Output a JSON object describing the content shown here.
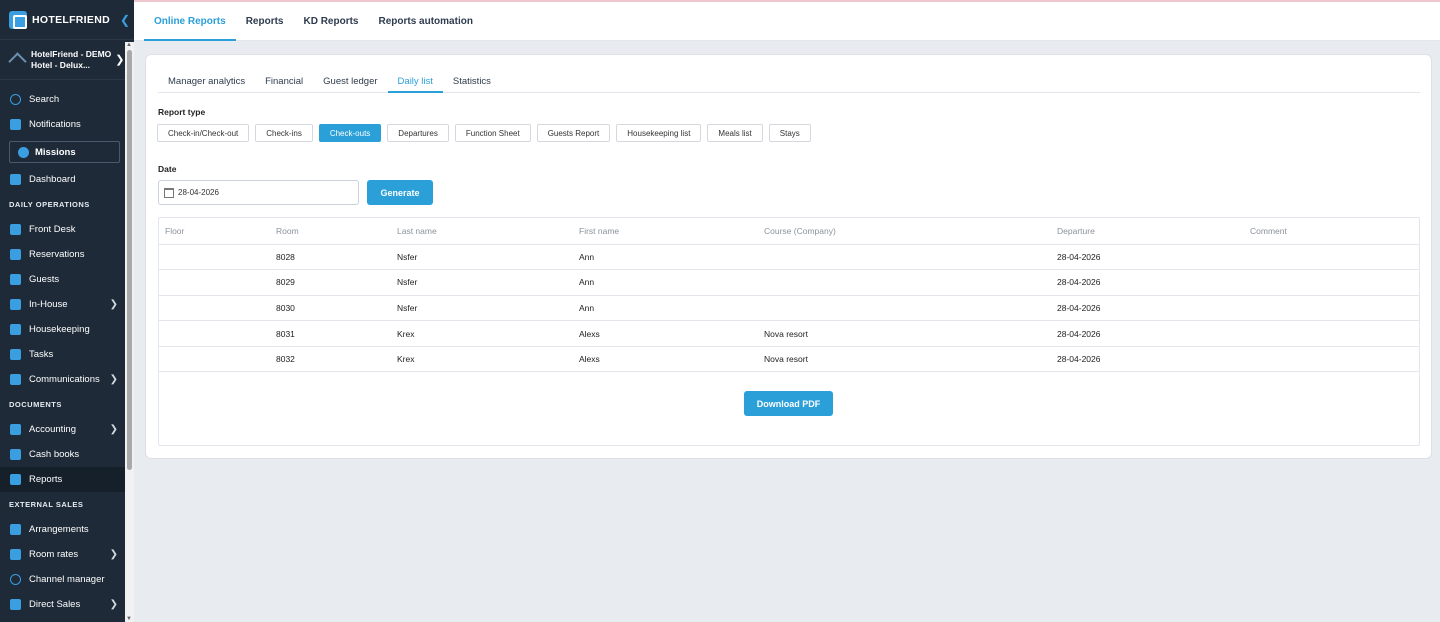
{
  "app": {
    "logo_text": "HOTELFRIEND",
    "hotel_name_line1": "HotelFriend - DEMO",
    "hotel_name_line2": "Hotel - Delux..."
  },
  "sidebar": {
    "search": "Search",
    "notifications": "Notifications",
    "missions": "Missions",
    "dashboard": "Dashboard",
    "section_daily": "DAILY OPERATIONS",
    "front_desk": "Front Desk",
    "reservations": "Reservations",
    "guests": "Guests",
    "in_house": "In-House",
    "housekeeping": "Housekeeping",
    "tasks": "Tasks",
    "communications": "Communications",
    "section_documents": "DOCUMENTS",
    "accounting": "Accounting",
    "cash_books": "Cash books",
    "reports": "Reports",
    "section_external": "EXTERNAL SALES",
    "arrangements": "Arrangements",
    "room_rates": "Room rates",
    "channel_manager": "Channel manager",
    "direct_sales": "Direct Sales"
  },
  "topnav": {
    "tabs": [
      "Online Reports",
      "Reports",
      "KD Reports",
      "Reports automation"
    ]
  },
  "subtabs": [
    "Manager analytics",
    "Financial",
    "Guest ledger",
    "Daily list",
    "Statistics"
  ],
  "form": {
    "report_type_label": "Report type",
    "report_types": [
      "Check-in/Check-out",
      "Check-ins",
      "Check-outs",
      "Departures",
      "Function Sheet",
      "Guests Report",
      "Housekeeping list",
      "Meals list",
      "Stays"
    ],
    "date_label": "Date",
    "date_value": "28-04-2026",
    "generate": "Generate"
  },
  "table": {
    "headers": [
      "Floor",
      "Room",
      "Last name",
      "First name",
      "Course (Company)",
      "Departure",
      "Comment"
    ],
    "rows": [
      [
        "",
        "8028",
        "Nsfer",
        "Ann",
        "",
        "28-04-2026",
        ""
      ],
      [
        "",
        "8029",
        "Nsfer",
        "Ann",
        "",
        "28-04-2026",
        ""
      ],
      [
        "",
        "8030",
        "Nsfer",
        "Ann",
        "",
        "28-04-2026",
        ""
      ],
      [
        "",
        "8031",
        "Krex",
        "Alexs",
        "Nova resort",
        "28-04-2026",
        ""
      ],
      [
        "",
        "8032",
        "Krex",
        "Alexs",
        "Nova resort",
        "28-04-2026",
        ""
      ]
    ],
    "download_pdf": "Download PDF"
  },
  "colors": {
    "accent": "#2a9fd8",
    "sidebar_bg": "#1e2a38",
    "page_bg": "#e8ebf0"
  }
}
